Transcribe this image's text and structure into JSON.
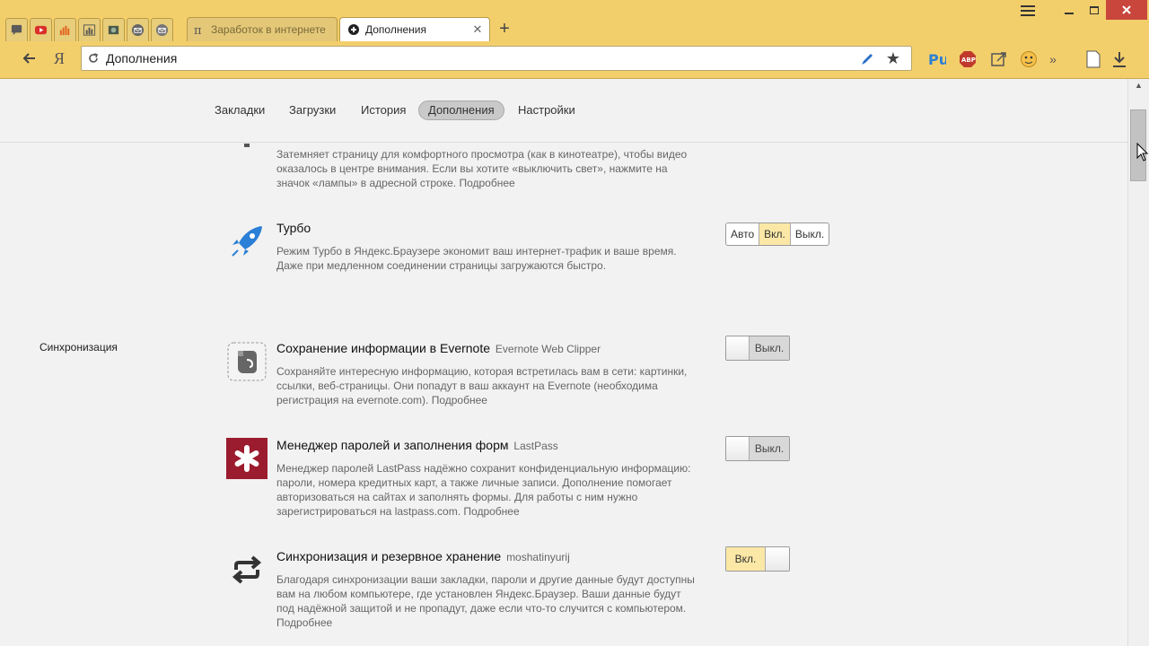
{
  "browser": {
    "pinned_tabs": [
      {
        "icon": "chat-icon"
      },
      {
        "icon": "youtube-icon"
      },
      {
        "icon": "bar-chart-icon"
      },
      {
        "icon": "bar-chart-icon"
      },
      {
        "icon": "photo-icon"
      },
      {
        "icon": "mail-icon"
      },
      {
        "icon": "mail-icon"
      }
    ],
    "background_tab": {
      "title": "Заработок в интернете",
      "icon": "pi-icon"
    },
    "active_tab": {
      "title": "Дополнения",
      "icon": "puzzle-icon"
    },
    "address": "Дополнения",
    "extensions": [
      "pu-icon",
      "adblock-icon",
      "share-icon",
      "face-icon"
    ],
    "more_extensions": "»"
  },
  "page": {
    "nav_tabs": [
      {
        "label": "Закладки",
        "active": false
      },
      {
        "label": "Загрузки",
        "active": false
      },
      {
        "label": "История",
        "active": false
      },
      {
        "label": "Дополнения",
        "active": true
      },
      {
        "label": "Настройки",
        "active": false
      }
    ],
    "section_sync": "Синхронизация",
    "addons": [
      {
        "name": "",
        "description": "Затемняет страницу для комфортного просмотра (как в кинотеатре), чтобы видео оказалось в центре внимания. Если вы хотите «выключить свет», нажмите на значок «лампы» в адресной строке.",
        "more": "Подробнее",
        "icon": "lamp-icon"
      },
      {
        "name": "Турбо",
        "subtitle": "",
        "description": "Режим Турбо в Яндекс.Браузере экономит ваш интернет-трафик и ваше время. Даже при медленном соединении страницы загружаются быстро.",
        "icon": "rocket-icon",
        "options": [
          "Авто",
          "Вкл.",
          "Выкл."
        ],
        "selected": "Вкл."
      },
      {
        "name": "Сохранение информации в Evernote",
        "subtitle": "Evernote Web Clipper",
        "description": "Сохраняйте интересную информацию, которая встретилась вам в сети: картинки, ссылки, веб-страницы. Они попадут в ваш аккаунт на Evernote (необходима регистрация на evernote.com).",
        "more": "Подробнее",
        "icon": "evernote-icon",
        "toggle": "Выкл."
      },
      {
        "name": "Менеджер паролей и заполнения форм",
        "subtitle": "LastPass",
        "description": "Менеджер паролей LastPass надёжно сохранит конфиденциальную информацию: пароли, номера кредитных карт, а также личные записи. Дополнение помогает авторизоваться на сайтах и заполнять формы. Для работы с ним нужно зарегистрироваться на lastpass.com.",
        "more": "Подробнее",
        "icon": "lastpass-icon",
        "toggle": "Выкл."
      },
      {
        "name": "Синхронизация и резервное хранение",
        "subtitle": "moshatinyurij",
        "description": "Благодаря синхронизации ваши закладки, пароли и другие данные будут доступны вам на любом компьютере, где установлен Яндекс.Браузер. Ваши данные будут под надёжной защитой и не пропадут, даже если что-то случится с компьютером.",
        "more": "Подробнее",
        "icon": "sync-icon",
        "toggle": "Вкл."
      }
    ]
  },
  "colors": {
    "chrome": "#f3cf6c",
    "toggle_on": "#fbe8a6",
    "toggle_off": "#d8d8d8",
    "lastpass": "#9b1c2e",
    "turbo": "#2a7fd6"
  }
}
